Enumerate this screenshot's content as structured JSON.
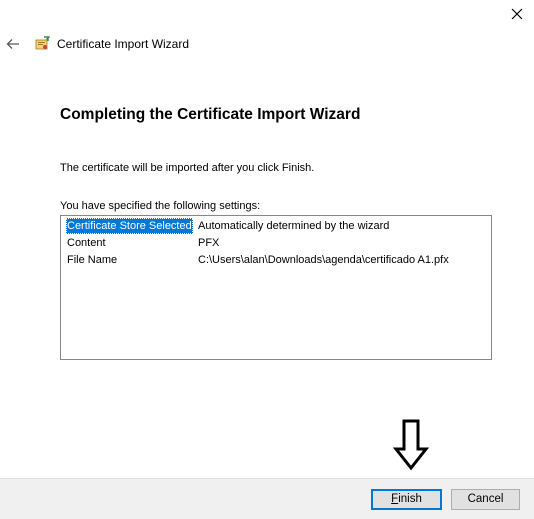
{
  "window": {
    "title": "Certificate Import Wizard",
    "close_icon": "close-icon",
    "back_icon": "back-arrow-icon",
    "app_icon": "certificate-wizard-icon"
  },
  "page": {
    "heading": "Completing the Certificate Import Wizard",
    "intro": "The certificate will be imported after you click Finish.",
    "settings_caption": "You have specified the following settings:"
  },
  "settings": [
    {
      "name": "Certificate Store Selected",
      "value": "Automatically determined by the wizard",
      "selected": true
    },
    {
      "name": "Content",
      "value": "PFX",
      "selected": false
    },
    {
      "name": "File Name",
      "value": "C:\\Users\\alan\\Downloads\\agenda\\certificado A1.pfx",
      "selected": false
    }
  ],
  "annotation": {
    "icon": "down-arrow-icon"
  },
  "footer": {
    "finish_accel": "F",
    "finish_rest": "inish",
    "cancel_label": "Cancel"
  },
  "colors": {
    "selection": "#0078d7",
    "footer_bg": "#f0f0f0",
    "default_button_border": "#0078d7"
  }
}
